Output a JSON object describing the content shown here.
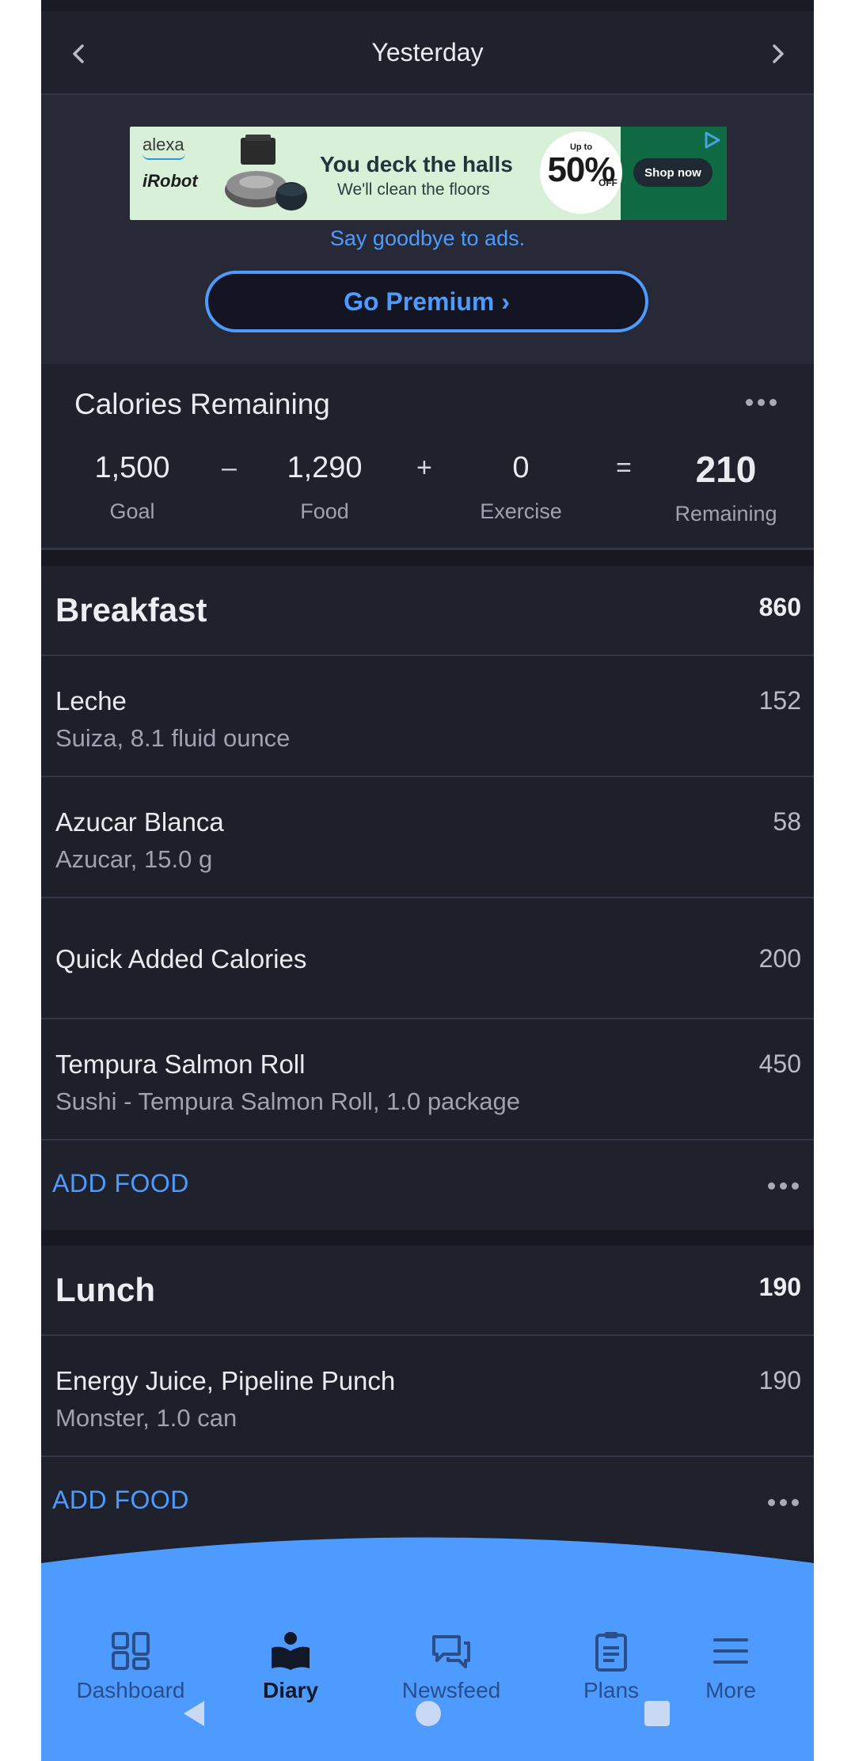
{
  "header": {
    "date_label": "Yesterday"
  },
  "ad": {
    "brand_top": "alexa",
    "brand_bottom": "iRobot",
    "headline": "You deck the halls",
    "subline": "We'll clean the floors",
    "upto": "Up to",
    "percent": "50%",
    "off": "OFF",
    "shop_label": "Shop now",
    "say_goodbye": "Say goodbye to ads.",
    "premium_label": "Go Premium ›"
  },
  "calories": {
    "title": "Calories Remaining",
    "goal_value": "1,500",
    "goal_label": "Goal",
    "minus": "–",
    "food_value": "1,290",
    "food_label": "Food",
    "plus": "+",
    "exercise_value": "0",
    "exercise_label": "Exercise",
    "equals": "=",
    "remaining_value": "210",
    "remaining_label": "Remaining"
  },
  "breakfast": {
    "name": "Breakfast",
    "total": "860",
    "items": [
      {
        "name": "Leche",
        "desc": "Suiza, 8.1 fluid ounce",
        "cal": "152"
      },
      {
        "name": "Azucar Blanca",
        "desc": "Azucar, 15.0 g",
        "cal": "58"
      },
      {
        "name": "Quick Added Calories",
        "desc": "",
        "cal": "200"
      },
      {
        "name": "Tempura Salmon Roll",
        "desc": "Sushi - Tempura Salmon Roll, 1.0 package",
        "cal": "450"
      }
    ],
    "add_label": "ADD FOOD"
  },
  "lunch": {
    "name": "Lunch",
    "total": "190",
    "items": [
      {
        "name": "Energy Juice, Pipeline Punch",
        "desc": "Monster, 1.0 can",
        "cal": "190"
      }
    ],
    "add_label": "ADD FOOD"
  },
  "bottom_nav": {
    "items": [
      {
        "label": "Dashboard",
        "icon": "dashboard-icon"
      },
      {
        "label": "Diary",
        "icon": "diary-icon",
        "active": true
      },
      {
        "label": "Newsfeed",
        "icon": "newsfeed-icon"
      },
      {
        "label": "Plans",
        "icon": "plans-icon"
      },
      {
        "label": "More",
        "icon": "menu-icon"
      }
    ]
  },
  "colors": {
    "background": "#1d1f2a",
    "accent": "#4e9bff",
    "nav_bar": "#4e9bff"
  }
}
